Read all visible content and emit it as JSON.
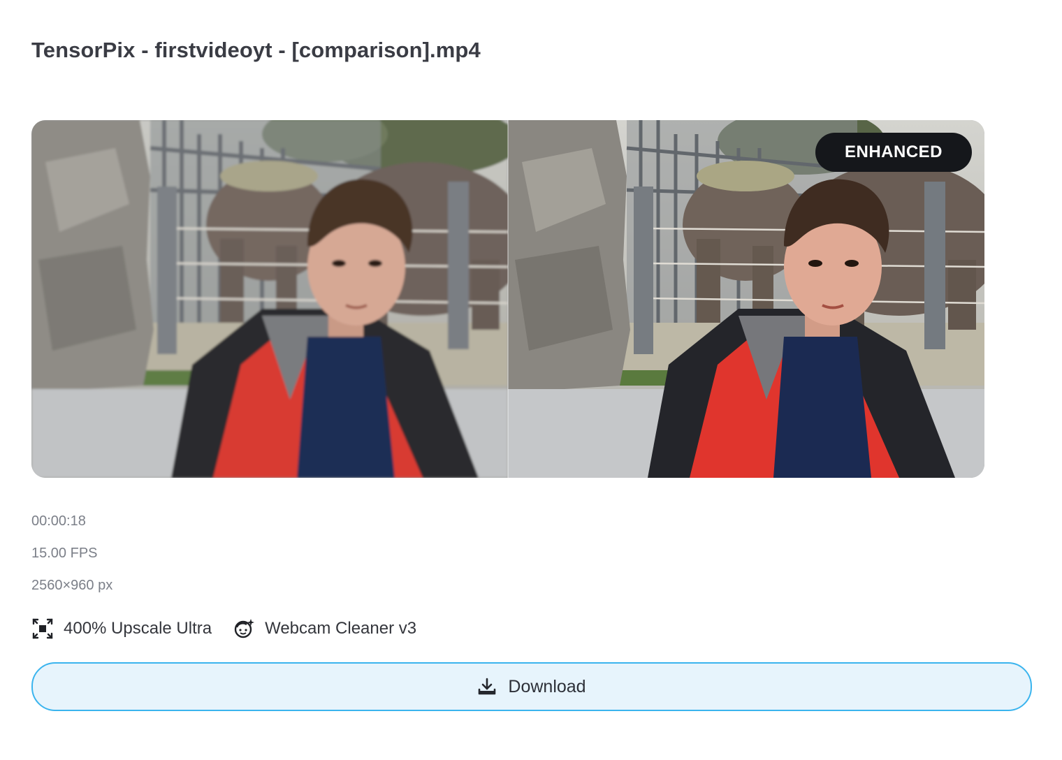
{
  "title": "TensorPix - firstvideoyt - [comparison].mp4",
  "preview": {
    "badge": "ENHANCED",
    "left_pane": "original-frame",
    "right_pane": "enhanced-frame"
  },
  "meta": {
    "duration": "00:00:18",
    "fps": "15.00 FPS",
    "resolution": "2560×960 px"
  },
  "features": [
    {
      "icon": "upscale-icon",
      "label": "400% Upscale Ultra"
    },
    {
      "icon": "face-sparkle-icon",
      "label": "Webcam Cleaner v3"
    }
  ],
  "download": {
    "icon": "download-icon",
    "label": "Download"
  },
  "colors": {
    "button_border": "#3ab4ee",
    "button_bg": "#e7f4fc",
    "badge_bg": "#15171b",
    "title": "#3a3c44",
    "meta": "#7b7f88"
  }
}
